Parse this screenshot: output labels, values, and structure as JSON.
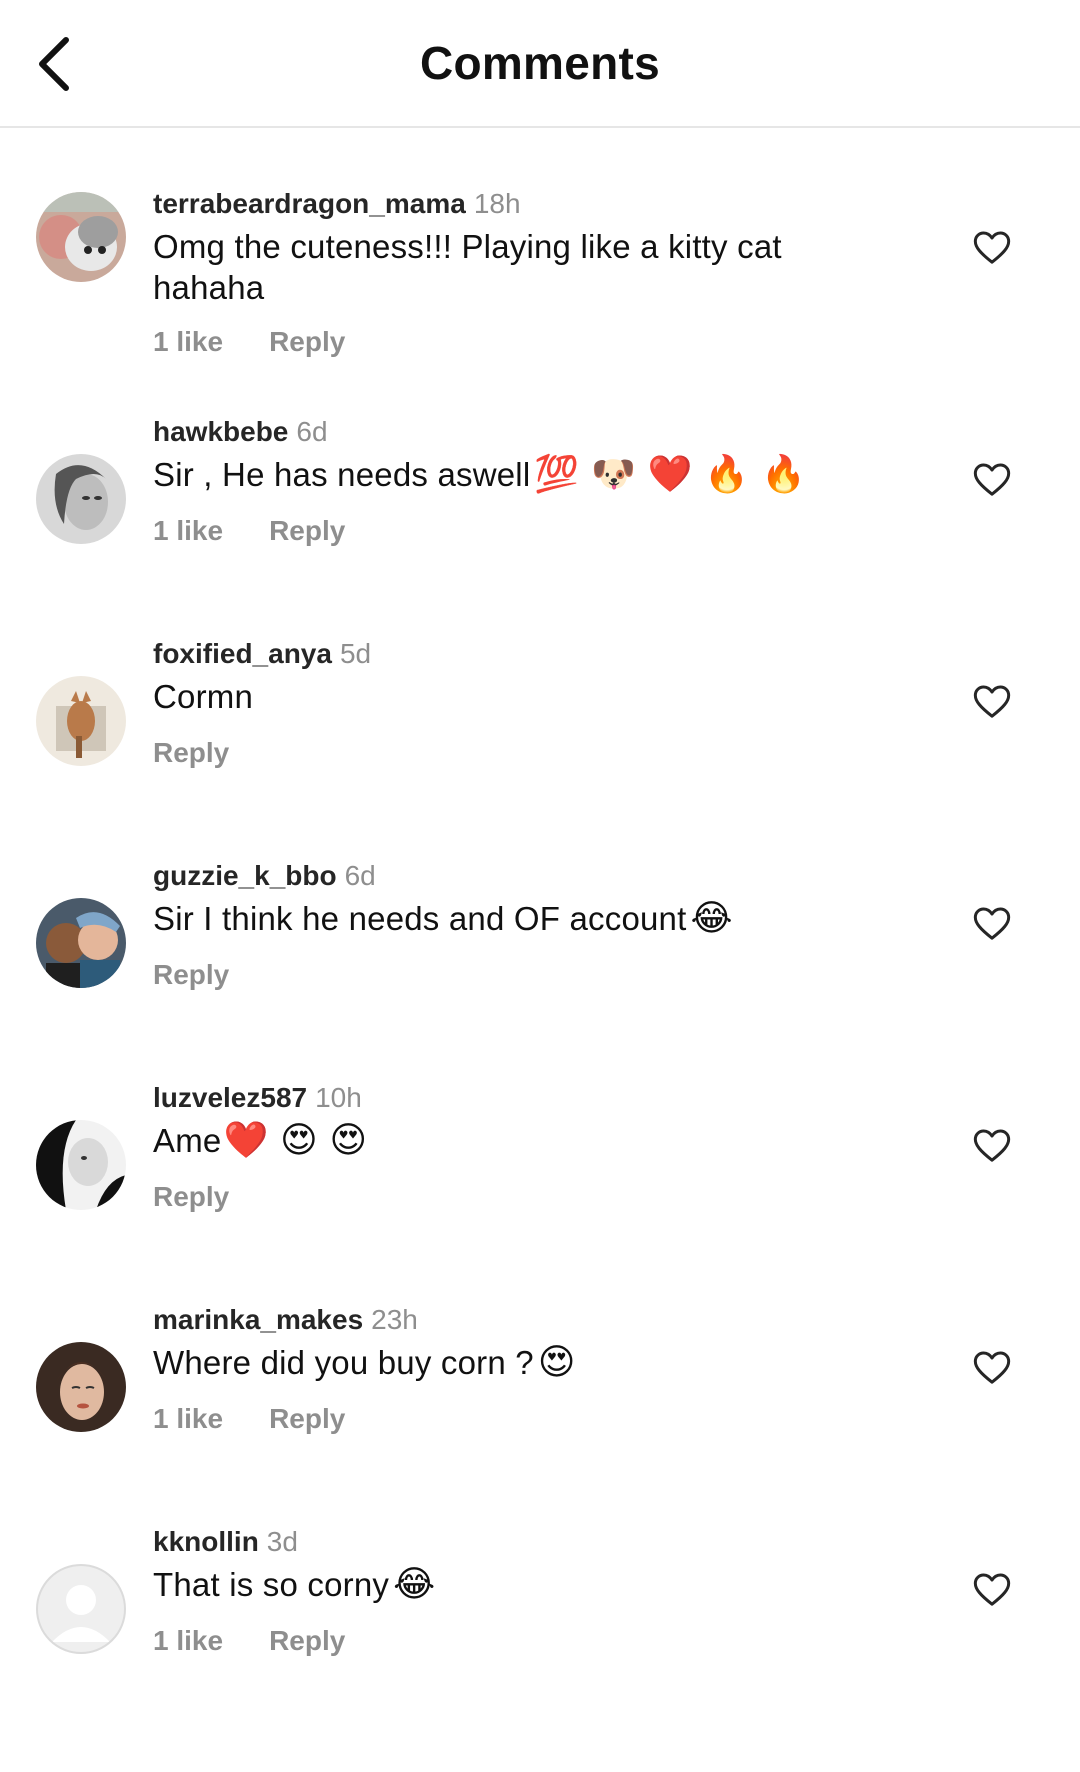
{
  "header": {
    "title": "Comments",
    "back_icon": "chevron-left-icon"
  },
  "reply_label": "Reply",
  "comments": [
    {
      "username": "terrabeardragon_mama",
      "time": "18h",
      "text": "Omg the cuteness!!! Playing like a kitty cat hahaha",
      "emojis": "",
      "likes": "1 like"
    },
    {
      "username": "hawkbebe",
      "time": "6d",
      "text": "Sir , He has needs aswell",
      "emojis": "💯 🐶 ❤️ 🔥 🔥",
      "likes": "1 like"
    },
    {
      "username": "foxified_anya",
      "time": "5d",
      "text": "Cormn",
      "emojis": "",
      "likes": ""
    },
    {
      "username": "guzzie_k_bbo",
      "time": "6d",
      "text": "Sir I think he needs and OF account",
      "emojis": "😂",
      "likes": ""
    },
    {
      "username": "luzvelez587",
      "time": "10h",
      "text": "Ame",
      "emojis": "❤️ 😍 😍",
      "likes": ""
    },
    {
      "username": "marinka_makes",
      "time": "23h",
      "text": "Where did you buy corn ?",
      "emojis": "😍",
      "likes": "1 like"
    },
    {
      "username": "kknollin",
      "time": "3d",
      "text": "That is so corny",
      "emojis": "😂",
      "likes": "1 like"
    }
  ],
  "icons": {
    "like": "heart-outline-icon",
    "default_avatar": "default-avatar-icon"
  }
}
